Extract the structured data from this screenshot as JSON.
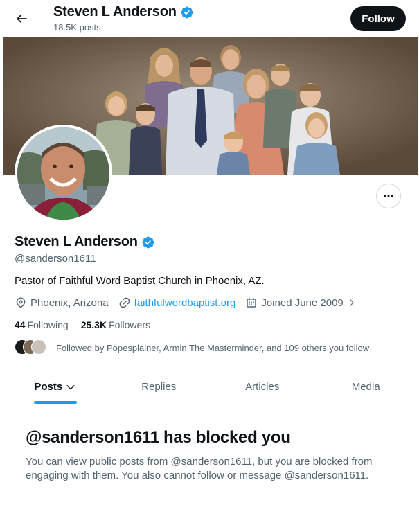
{
  "header": {
    "name": "Steven L Anderson",
    "posts_count": "18.5K posts",
    "follow_label": "Follow"
  },
  "profile": {
    "name": "Steven L Anderson",
    "handle": "@sanderson1611",
    "bio": "Pastor of Faithful Word Baptist Church in Phoenix, AZ.",
    "location": "Phoenix, Arizona",
    "website": "faithfulwordbaptist.org",
    "joined": "Joined June 2009",
    "following_count": "44",
    "following_label": "Following",
    "followers_count": "25.3K",
    "followers_label": "Followers",
    "followed_by": "Followed by Popesplainer, Armin The Masterminder, and 109 others you follow",
    "verified": true
  },
  "tabs": [
    {
      "label": "Posts",
      "active": true
    },
    {
      "label": "Replies",
      "active": false
    },
    {
      "label": "Articles",
      "active": false
    },
    {
      "label": "Media",
      "active": false
    }
  ],
  "blocked": {
    "title": "@sanderson1611 has blocked you",
    "body": "You can view public posts from @sanderson1611, but you are blocked from engaging with them. You also cannot follow or message @sanderson1611."
  },
  "icons": {
    "back": "back-arrow-icon",
    "verified": "verified-badge-icon",
    "more": "more-dots-icon",
    "location": "location-pin-icon",
    "link": "link-icon",
    "calendar": "calendar-icon",
    "chevron": "chevron-right-icon",
    "tab_chevron": "chevron-down-icon"
  },
  "colors": {
    "accent": "#1d9bf0",
    "text": "#0f1419",
    "muted": "#536471",
    "follow_bg": "#0f1419"
  }
}
